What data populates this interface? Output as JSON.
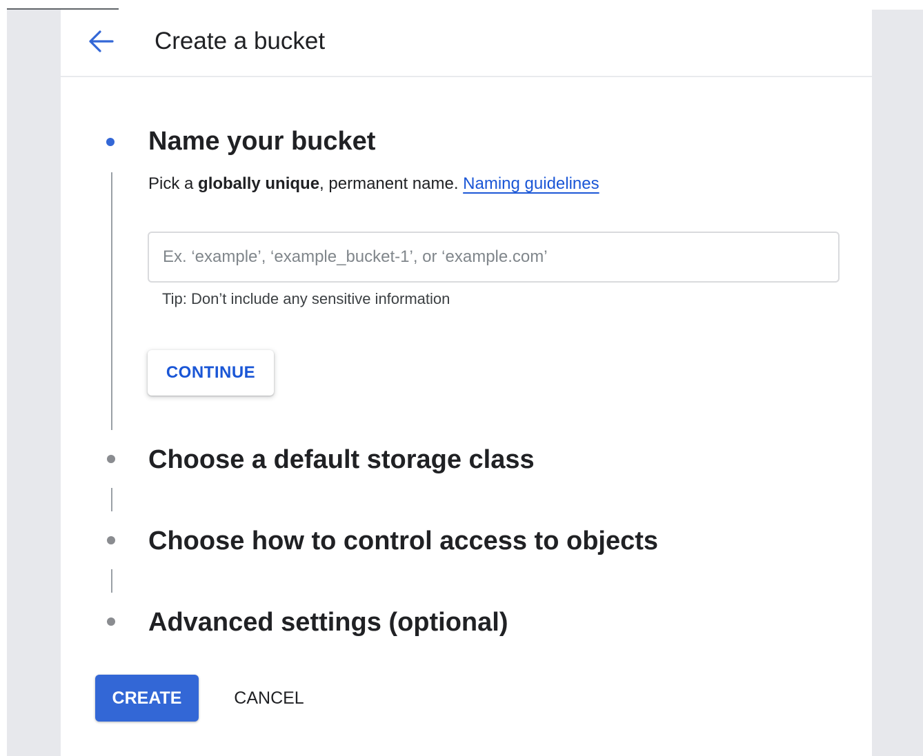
{
  "header": {
    "back_icon": "arrow-left-icon",
    "title": "Create a bucket"
  },
  "steps": [
    {
      "title": "Name your bucket",
      "active": true,
      "description": {
        "prefix": "Pick a ",
        "bold": "globally unique",
        "suffix": ", permanent name. ",
        "link": "Naming guidelines"
      },
      "input": {
        "value": "",
        "placeholder": "Ex. ‘example’, ‘example_bucket-1’, or ‘example.com’"
      },
      "tip": "Tip: Don’t include any sensitive information",
      "continue_label": "CONTINUE"
    },
    {
      "title": "Choose a default storage class",
      "active": false
    },
    {
      "title": "Choose how to control access to objects",
      "active": false
    },
    {
      "title": "Advanced settings (optional)",
      "active": false
    }
  ],
  "actions": {
    "create_label": "CREATE",
    "cancel_label": "CANCEL"
  },
  "colors": {
    "accent": "#3367d6",
    "link": "#1a56d6",
    "text": "#202124",
    "side_background": "#e7e8ec"
  }
}
